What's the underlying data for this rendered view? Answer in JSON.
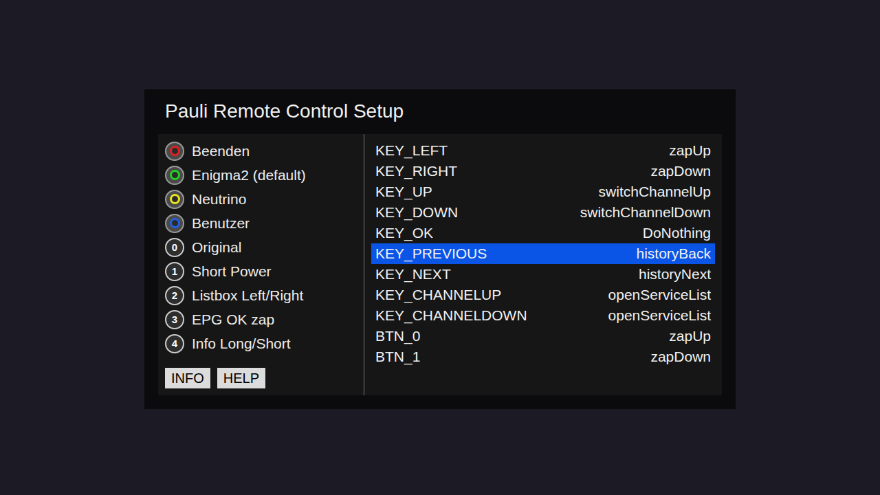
{
  "window": {
    "title": "Pauli Remote Control Setup"
  },
  "options": [
    {
      "kind": "color",
      "key": "",
      "color": "#e02020",
      "label": "Beenden"
    },
    {
      "kind": "color",
      "key": "",
      "color": "#20d020",
      "label": "Enigma2 (default)"
    },
    {
      "kind": "color",
      "key": "",
      "color": "#e8e020",
      "label": "Neutrino"
    },
    {
      "kind": "color",
      "key": "",
      "color": "#2060e0",
      "label": "Benutzer"
    },
    {
      "kind": "number",
      "key": "0",
      "color": "#cccccc",
      "label": "Original"
    },
    {
      "kind": "number",
      "key": "1",
      "color": "#cccccc",
      "label": "Short Power"
    },
    {
      "kind": "number",
      "key": "2",
      "color": "#cccccc",
      "label": "Listbox Left/Right"
    },
    {
      "kind": "number",
      "key": "3",
      "color": "#cccccc",
      "label": "EPG OK zap"
    },
    {
      "kind": "number",
      "key": "4",
      "color": "#cccccc",
      "label": "Info Long/Short"
    }
  ],
  "buttons": [
    "INFO",
    "HELP"
  ],
  "mappings": [
    {
      "key": "KEY_LEFT",
      "action": "zapUp",
      "selected": false
    },
    {
      "key": "KEY_RIGHT",
      "action": "zapDown",
      "selected": false
    },
    {
      "key": "KEY_UP",
      "action": "switchChannelUp",
      "selected": false
    },
    {
      "key": "KEY_DOWN",
      "action": "switchChannelDown",
      "selected": false
    },
    {
      "key": "KEY_OK",
      "action": "DoNothing",
      "selected": false
    },
    {
      "key": "KEY_PREVIOUS",
      "action": "historyBack",
      "selected": true
    },
    {
      "key": "KEY_NEXT",
      "action": "historyNext",
      "selected": false
    },
    {
      "key": "KEY_CHANNELUP",
      "action": "openServiceList",
      "selected": false
    },
    {
      "key": "KEY_CHANNELDOWN",
      "action": "openServiceList",
      "selected": false
    },
    {
      "key": "BTN_0",
      "action": "zapUp",
      "selected": false
    },
    {
      "key": "BTN_1",
      "action": "zapDown",
      "selected": false
    }
  ]
}
